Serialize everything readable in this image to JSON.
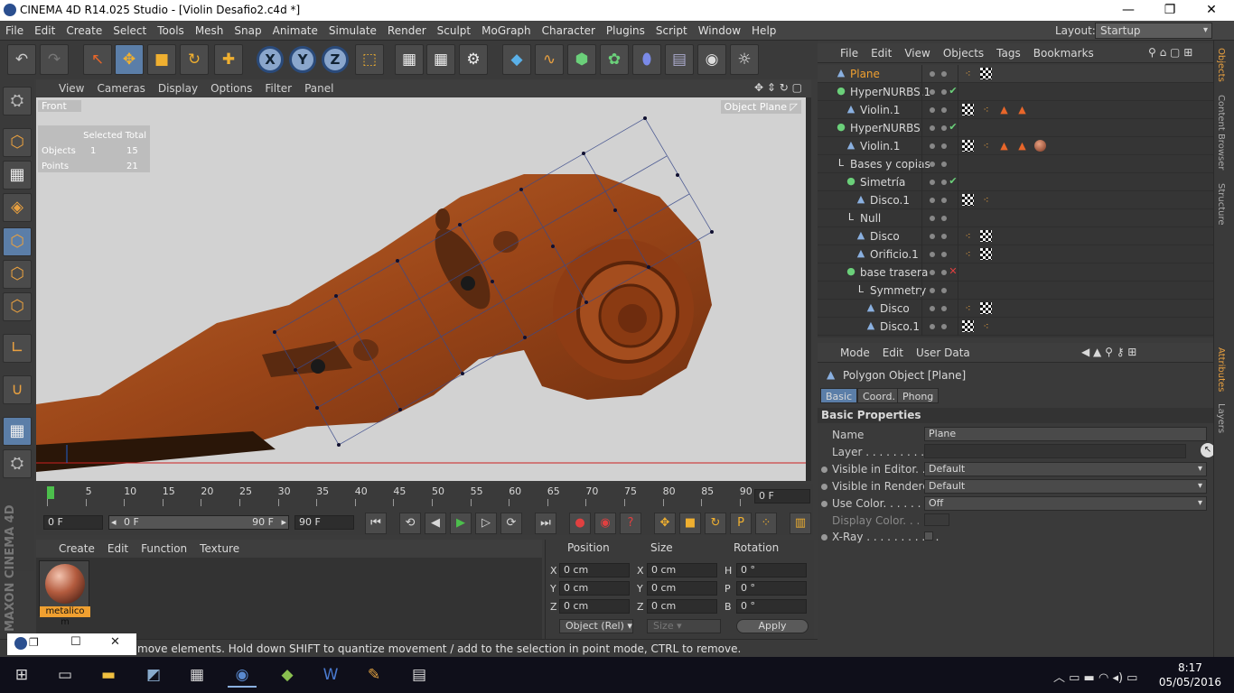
{
  "window": {
    "title": "CINEMA 4D R14.025 Studio - [Violin Desafio2.c4d *]",
    "minimize": "—",
    "restore": "❐",
    "close": "✕"
  },
  "menu": [
    "File",
    "Edit",
    "Create",
    "Select",
    "Tools",
    "Mesh",
    "Snap",
    "Animate",
    "Simulate",
    "Render",
    "Sculpt",
    "MoGraph",
    "Character",
    "Plugins",
    "Script",
    "Window",
    "Help"
  ],
  "layout": {
    "label": "Layout:",
    "value": "Startup"
  },
  "viewport": {
    "menu": [
      "View",
      "Cameras",
      "Display",
      "Options",
      "Filter",
      "Panel"
    ],
    "view_name": "Front",
    "object_label": "Object",
    "object_value": "Plane",
    "stats_headers": [
      "Selected",
      "Total"
    ],
    "stats_rows": [
      [
        "Objects",
        "1",
        "15"
      ],
      [
        "Points",
        "",
        "21"
      ]
    ]
  },
  "timeline": {
    "ticks": [
      "0",
      "5",
      "10",
      "15",
      "20",
      "25",
      "30",
      "35",
      "40",
      "45",
      "50",
      "55",
      "60",
      "65",
      "70",
      "75",
      "80",
      "85",
      "90"
    ],
    "current_frame": "0 F"
  },
  "playback": {
    "start": "0 F",
    "range_start": "0 F",
    "range_end": "90 F",
    "end": "90 F"
  },
  "material": {
    "menu": [
      "Create",
      "Edit",
      "Function",
      "Texture"
    ],
    "name": "metalico m"
  },
  "coords": {
    "headers": [
      "Position",
      "Size",
      "Rotation"
    ],
    "pos": [
      {
        "axis": "X",
        "value": "0 cm"
      },
      {
        "axis": "Y",
        "value": "0 cm"
      },
      {
        "axis": "Z",
        "value": "0 cm"
      }
    ],
    "size": [
      {
        "axis": "X",
        "value": "0 cm"
      },
      {
        "axis": "Y",
        "value": "0 cm"
      },
      {
        "axis": "Z",
        "value": "0 cm"
      }
    ],
    "rot": [
      {
        "axis": "H",
        "value": "0 °"
      },
      {
        "axis": "P",
        "value": "0 °"
      },
      {
        "axis": "B",
        "value": "0 °"
      }
    ],
    "mode": "Object (Rel)",
    "size_mode": "Size",
    "apply": "Apply"
  },
  "brand": "MAXON CINEMA 4D",
  "status": "move elements. Hold down SHIFT to quantize movement / add to the selection in point mode, CTRL to remove.",
  "objects": {
    "menu": [
      "File",
      "Edit",
      "View",
      "Objects",
      "Tags",
      "Bookmarks"
    ],
    "rows": [
      {
        "name": "Plane",
        "indent": 0,
        "icon": "▲",
        "selected": true,
        "tags": [
          "dots",
          "chk"
        ]
      },
      {
        "name": "HyperNURBS.1",
        "indent": 0,
        "icon": "●",
        "tags": [],
        "state": "✔"
      },
      {
        "name": "Violin.1",
        "indent": 1,
        "icon": "▲",
        "tags": [
          "chk",
          "dots",
          "tri",
          "tri"
        ]
      },
      {
        "name": "HyperNURBS",
        "indent": 0,
        "icon": "●",
        "tags": [],
        "state": "✔"
      },
      {
        "name": "Violin.1",
        "indent": 1,
        "icon": "▲",
        "tags": [
          "chk",
          "dots",
          "tri",
          "tri",
          "mat"
        ]
      },
      {
        "name": "Bases y copias",
        "indent": 0,
        "icon": "L",
        "tags": []
      },
      {
        "name": "Simetría",
        "indent": 1,
        "icon": "●",
        "tags": [],
        "state": "✔"
      },
      {
        "name": "Disco.1",
        "indent": 2,
        "icon": "▲",
        "tags": [
          "chk",
          "dots"
        ]
      },
      {
        "name": "Null",
        "indent": 1,
        "icon": "L",
        "tags": []
      },
      {
        "name": "Disco",
        "indent": 2,
        "icon": "▲",
        "tags": [
          "dots",
          "chk"
        ]
      },
      {
        "name": "Orificio.1",
        "indent": 2,
        "icon": "▲",
        "tags": [
          "dots",
          "chk"
        ]
      },
      {
        "name": "base trasera",
        "indent": 1,
        "icon": "●",
        "tags": [],
        "state": "✕"
      },
      {
        "name": "Symmetry",
        "indent": 2,
        "icon": "L",
        "tags": []
      },
      {
        "name": "Disco",
        "indent": 3,
        "icon": "▲",
        "tags": [
          "dots",
          "chk"
        ]
      },
      {
        "name": "Disco.1",
        "indent": 3,
        "icon": "▲",
        "tags": [
          "chk",
          "dots"
        ]
      }
    ]
  },
  "attributes": {
    "menu": [
      "Mode",
      "Edit",
      "User Data"
    ],
    "title": "Polygon Object [Plane]",
    "tabs": [
      "Basic",
      "Coord.",
      "Phong"
    ],
    "section": "Basic Properties",
    "fields": [
      {
        "label": "Name",
        "value": "Plane"
      },
      {
        "label": "Layer . . . . . . . . . . .",
        "value": ""
      },
      {
        "label": "Visible in Editor. . .",
        "value": "Default"
      },
      {
        "label": "Visible in Renderer",
        "value": "Default"
      },
      {
        "label": "Use Color. . . . . . . .",
        "value": "Off"
      },
      {
        "label": "Display Color. . . .",
        "value": ""
      },
      {
        "label": "X-Ray . . . . . . . . . . .",
        "value": ""
      }
    ]
  },
  "sidetabs": [
    "Objects",
    "Content Browser",
    "Structure",
    "Attributes",
    "Layers"
  ],
  "taskbar": {
    "time": "8:17",
    "date": "05/05/2016"
  }
}
